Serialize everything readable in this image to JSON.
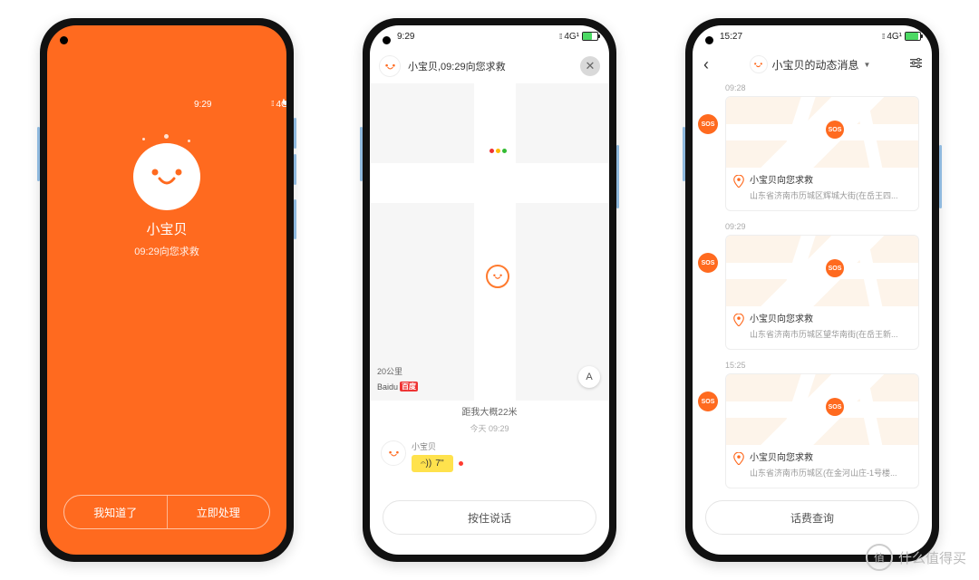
{
  "status": {
    "time_p1": "9:29",
    "time_p2": "9:29",
    "time_p3": "15:27",
    "net": "4G¹"
  },
  "p1": {
    "name": "小宝贝",
    "subtitle": "09:29向您求救",
    "btn_left": "我知道了",
    "btn_right": "立即处理"
  },
  "p2": {
    "header": "小宝贝,09:29向您求救",
    "scale": "20公里",
    "baidu": "Baidu",
    "baidu_tag": "百度",
    "compass": "A",
    "distance": "距我大概22米",
    "timestamp": "今天 09:29",
    "voice_name": "小宝贝",
    "voice_len": "7''",
    "talk": "按住说话"
  },
  "p3": {
    "title": "小宝贝的动态消息",
    "items": [
      {
        "time": "09:28",
        "title": "小宝贝向您求救",
        "addr": "山东省济南市历城区辉城大街(在岳王四...",
        "sos": "SOS"
      },
      {
        "time": "09:29",
        "title": "小宝贝向您求救",
        "addr": "山东省济南市历城区望华南街(在岳王新...",
        "sos": "SOS"
      },
      {
        "time": "15:25",
        "title": "小宝贝向您求救",
        "addr": "山东省济南市历城区(在金河山庄-1号楼...",
        "sos": "SOS"
      }
    ],
    "query": "话费查询"
  },
  "wm": "什么值得买"
}
